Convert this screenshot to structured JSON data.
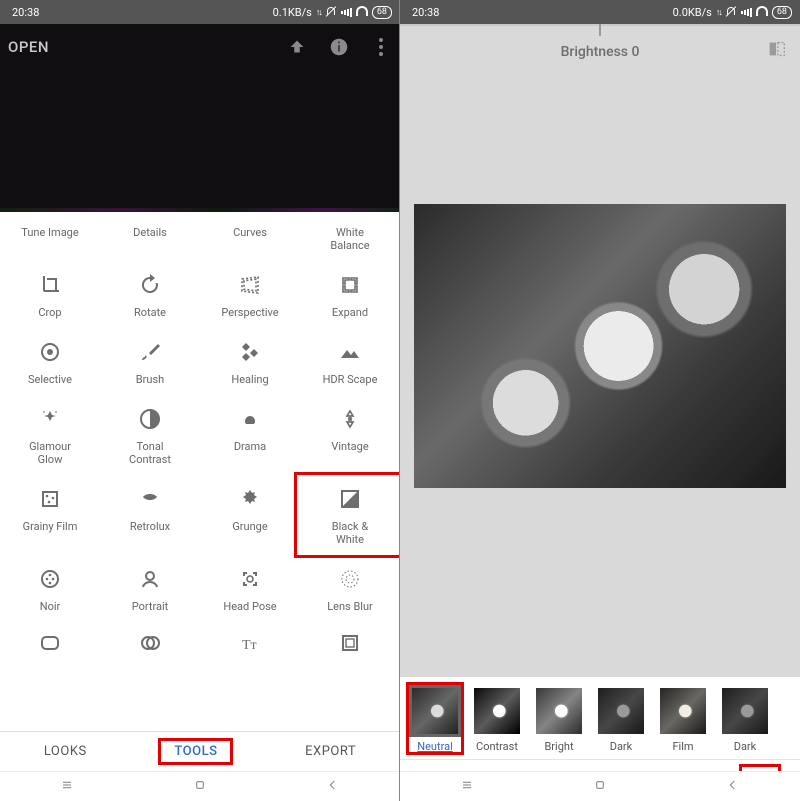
{
  "status": {
    "time": "20:38",
    "net_left": "0.1KB/s",
    "net_right": "0.0KB/s",
    "battery": "68"
  },
  "left": {
    "open": "OPEN",
    "tools_row0": [
      "Tune Image",
      "Details",
      "Curves",
      "White\nBalance"
    ],
    "tools": [
      [
        "Crop",
        "Rotate",
        "Perspective",
        "Expand"
      ],
      [
        "Selective",
        "Brush",
        "Healing",
        "HDR Scape"
      ],
      [
        "Glamour\nGlow",
        "Tonal\nContrast",
        "Drama",
        "Vintage"
      ],
      [
        "Grainy Film",
        "Retrolux",
        "Grunge",
        "Black &\nWhite"
      ],
      [
        "Noir",
        "Portrait",
        "Head Pose",
        "Lens Blur"
      ]
    ],
    "nav": {
      "looks": "LOOKS",
      "tools": "TOOLS",
      "export": "EXPORT"
    }
  },
  "right": {
    "brightness_label": "Brightness 0",
    "filters": [
      "Neutral",
      "Contrast",
      "Bright",
      "Dark",
      "Film",
      "Dark"
    ]
  }
}
